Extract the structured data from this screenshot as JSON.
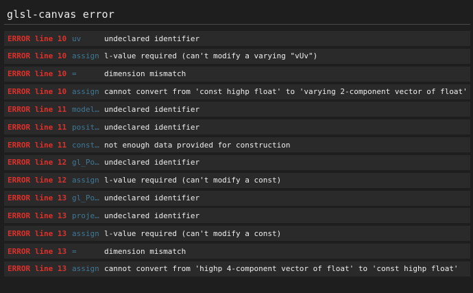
{
  "window": {
    "title": "glsl-canvas error"
  },
  "errors": [
    {
      "label": "ERROR line 10",
      "ident": "uv",
      "message": "undeclared identifier"
    },
    {
      "label": "ERROR line 10",
      "ident": "assign",
      "message": "l-value required (can't modify a varying \"vUv\")"
    },
    {
      "label": "ERROR line 10",
      "ident": "=",
      "message": "dimension mismatch"
    },
    {
      "label": "ERROR line 10",
      "ident": "assign",
      "message": "cannot convert from 'const highp float' to 'varying 2-component vector of float'"
    },
    {
      "label": "ERROR line 11",
      "ident": "modelV…",
      "message": "undeclared identifier"
    },
    {
      "label": "ERROR line 11",
      "ident": "positi…",
      "message": "undeclared identifier"
    },
    {
      "label": "ERROR line 11",
      "ident": "constr…",
      "message": "not enough data provided for construction"
    },
    {
      "label": "ERROR line 12",
      "ident": "gl_Poi…",
      "message": "undeclared identifier"
    },
    {
      "label": "ERROR line 12",
      "ident": "assign",
      "message": "l-value required (can't modify a const)"
    },
    {
      "label": "ERROR line 13",
      "ident": "gl_Pos…",
      "message": "undeclared identifier"
    },
    {
      "label": "ERROR line 13",
      "ident": "projec…",
      "message": "undeclared identifier"
    },
    {
      "label": "ERROR line 13",
      "ident": "assign",
      "message": "l-value required (can't modify a const)"
    },
    {
      "label": "ERROR line 13",
      "ident": "=",
      "message": "dimension mismatch"
    },
    {
      "label": "ERROR line 13",
      "ident": "assign",
      "message": "cannot convert from 'highp 4-component vector of float' to 'const highp float'"
    }
  ],
  "colors": {
    "error": "#e0302b",
    "identifier": "#3f7896",
    "message": "#ededed",
    "background": "#1e1e1e",
    "row": "#2a2a2a"
  }
}
